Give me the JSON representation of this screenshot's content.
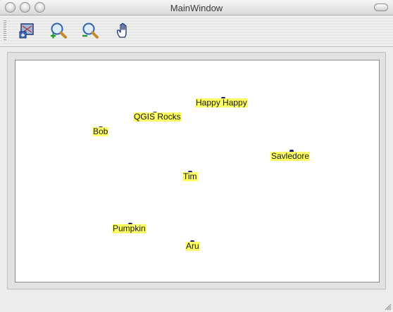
{
  "window": {
    "title": "MainWindow"
  },
  "toolbar": {
    "tools": [
      {
        "icon": "map-layer-icon"
      },
      {
        "icon": "zoom-in-icon"
      },
      {
        "icon": "zoom-out-icon"
      },
      {
        "icon": "pan-hand-icon"
      }
    ]
  },
  "map": {
    "labels": [
      {
        "text": "Happy Happy"
      },
      {
        "text": "QGIS Rocks"
      },
      {
        "text": "Bob"
      },
      {
        "text": "Savledore"
      },
      {
        "text": "Tim"
      },
      {
        "text": "Pumpkin"
      },
      {
        "text": "Aru"
      }
    ],
    "label_color": "#ffff66",
    "marker_color": "#1b1f7a"
  }
}
